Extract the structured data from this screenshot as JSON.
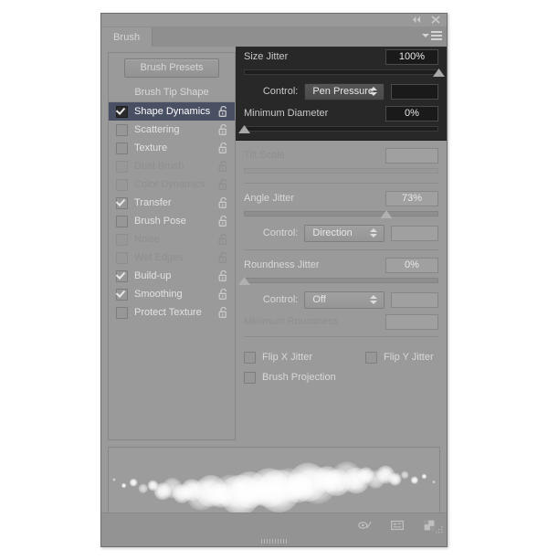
{
  "panel": {
    "tab_label": "Brush",
    "collapse_icon": "double-left-arrow-icon",
    "close_icon": "close-icon",
    "menu_icon": "panel-menu-icon"
  },
  "sidebar": {
    "presets_button": "Brush Presets",
    "tip_shape_label": "Brush Tip Shape",
    "items": [
      {
        "label": "Shape Dynamics",
        "checked": true,
        "selected": true,
        "disabled": false
      },
      {
        "label": "Scattering",
        "checked": false,
        "selected": false,
        "disabled": false
      },
      {
        "label": "Texture",
        "checked": false,
        "selected": false,
        "disabled": false
      },
      {
        "label": "Dual Brush",
        "checked": false,
        "selected": false,
        "disabled": true
      },
      {
        "label": "Color Dynamics",
        "checked": false,
        "selected": false,
        "disabled": true
      },
      {
        "label": "Transfer",
        "checked": true,
        "selected": false,
        "disabled": false
      },
      {
        "label": "Brush Pose",
        "checked": false,
        "selected": false,
        "disabled": false
      },
      {
        "label": "Noise",
        "checked": false,
        "selected": false,
        "disabled": true
      },
      {
        "label": "Wet Edges",
        "checked": false,
        "selected": false,
        "disabled": true
      },
      {
        "label": "Build-up",
        "checked": true,
        "selected": false,
        "disabled": false
      },
      {
        "label": "Smoothing",
        "checked": true,
        "selected": false,
        "disabled": false
      },
      {
        "label": "Protect Texture",
        "checked": false,
        "selected": false,
        "disabled": false
      }
    ],
    "lock_icon": "unlock-icon"
  },
  "options": {
    "size_jitter": {
      "label": "Size Jitter",
      "value": "100%",
      "slider_pct": 100
    },
    "size_control": {
      "label": "Control:",
      "value": "Pen Pressure",
      "extra_value": ""
    },
    "minimum_diameter": {
      "label": "Minimum Diameter",
      "value": "0%",
      "slider_pct": 0
    },
    "tilt_scale": {
      "label": "Tilt Scale",
      "value": "",
      "slider_pct": 0,
      "disabled": true
    },
    "angle_jitter": {
      "label": "Angle Jitter",
      "value": "73%",
      "slider_pct": 73
    },
    "angle_control": {
      "label": "Control:",
      "value": "Direction",
      "extra_value": ""
    },
    "roundness_jitter": {
      "label": "Roundness Jitter",
      "value": "0%",
      "slider_pct": 0
    },
    "roundness_control": {
      "label": "Control:",
      "value": "Off",
      "extra_value": ""
    },
    "minimum_roundness": {
      "label": "Minimum Roundness",
      "value": "",
      "disabled": true
    },
    "flip_x": {
      "label": "Flip X Jitter",
      "checked": false
    },
    "flip_y": {
      "label": "Flip Y Jitter",
      "checked": false
    },
    "brush_projection": {
      "label": "Brush Projection",
      "checked": false
    }
  },
  "footer": {
    "icons": [
      "toggle-brush-icon",
      "new-preset-icon",
      "new-brush-icon"
    ],
    "resize_grip": "resize-grip-icon",
    "drag_handle": "drag-handle-icon"
  },
  "colors": {
    "panel_bg": "#9a9a9a",
    "dark_section": "#282828",
    "selection": "#4a5064",
    "text": "#d8d8d8",
    "text_disabled": "#8f8f8f"
  }
}
